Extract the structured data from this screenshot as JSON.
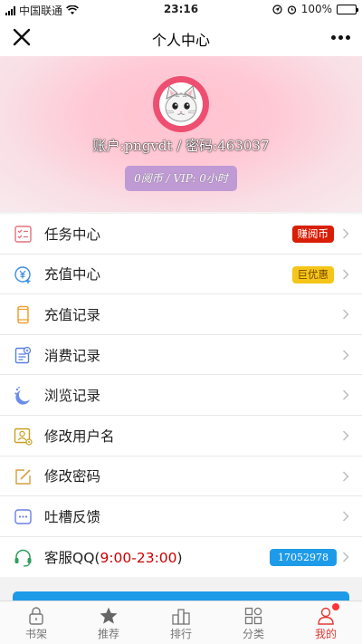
{
  "status_bar": {
    "carrier": "中国联通",
    "time": "23:16",
    "battery": "100%"
  },
  "nav": {
    "title": "个人中心"
  },
  "profile": {
    "account_line": "账户:pngvdt / 密码:463037",
    "vip_line": "0阅币 / VIP: 0小时"
  },
  "menu": [
    {
      "label": "任务中心",
      "badge": "赚阅币"
    },
    {
      "label": "充值中心",
      "badge": "巨优惠"
    },
    {
      "label": "充值记录"
    },
    {
      "label": "消费记录"
    },
    {
      "label": "浏览记录"
    },
    {
      "label": "修改用户名"
    },
    {
      "label": "修改密码"
    },
    {
      "label": "吐槽反馈"
    },
    {
      "label_prefix": "客服QQ(",
      "label_hours": "9:00-23:00",
      "label_suffix": ")",
      "badge": "17052978"
    }
  ],
  "tabs": [
    {
      "label": "书架"
    },
    {
      "label": "推荐"
    },
    {
      "label": "排行"
    },
    {
      "label": "分类"
    },
    {
      "label": "我的",
      "active": true
    }
  ],
  "colors": {
    "accent_red": "#e53935",
    "badge_red": "#d81e06",
    "badge_yellow": "#f5c518",
    "qq_blue": "#1e9be8",
    "avatar_ring": "#ee4f70",
    "vip_pill": "#bf9ad4"
  }
}
